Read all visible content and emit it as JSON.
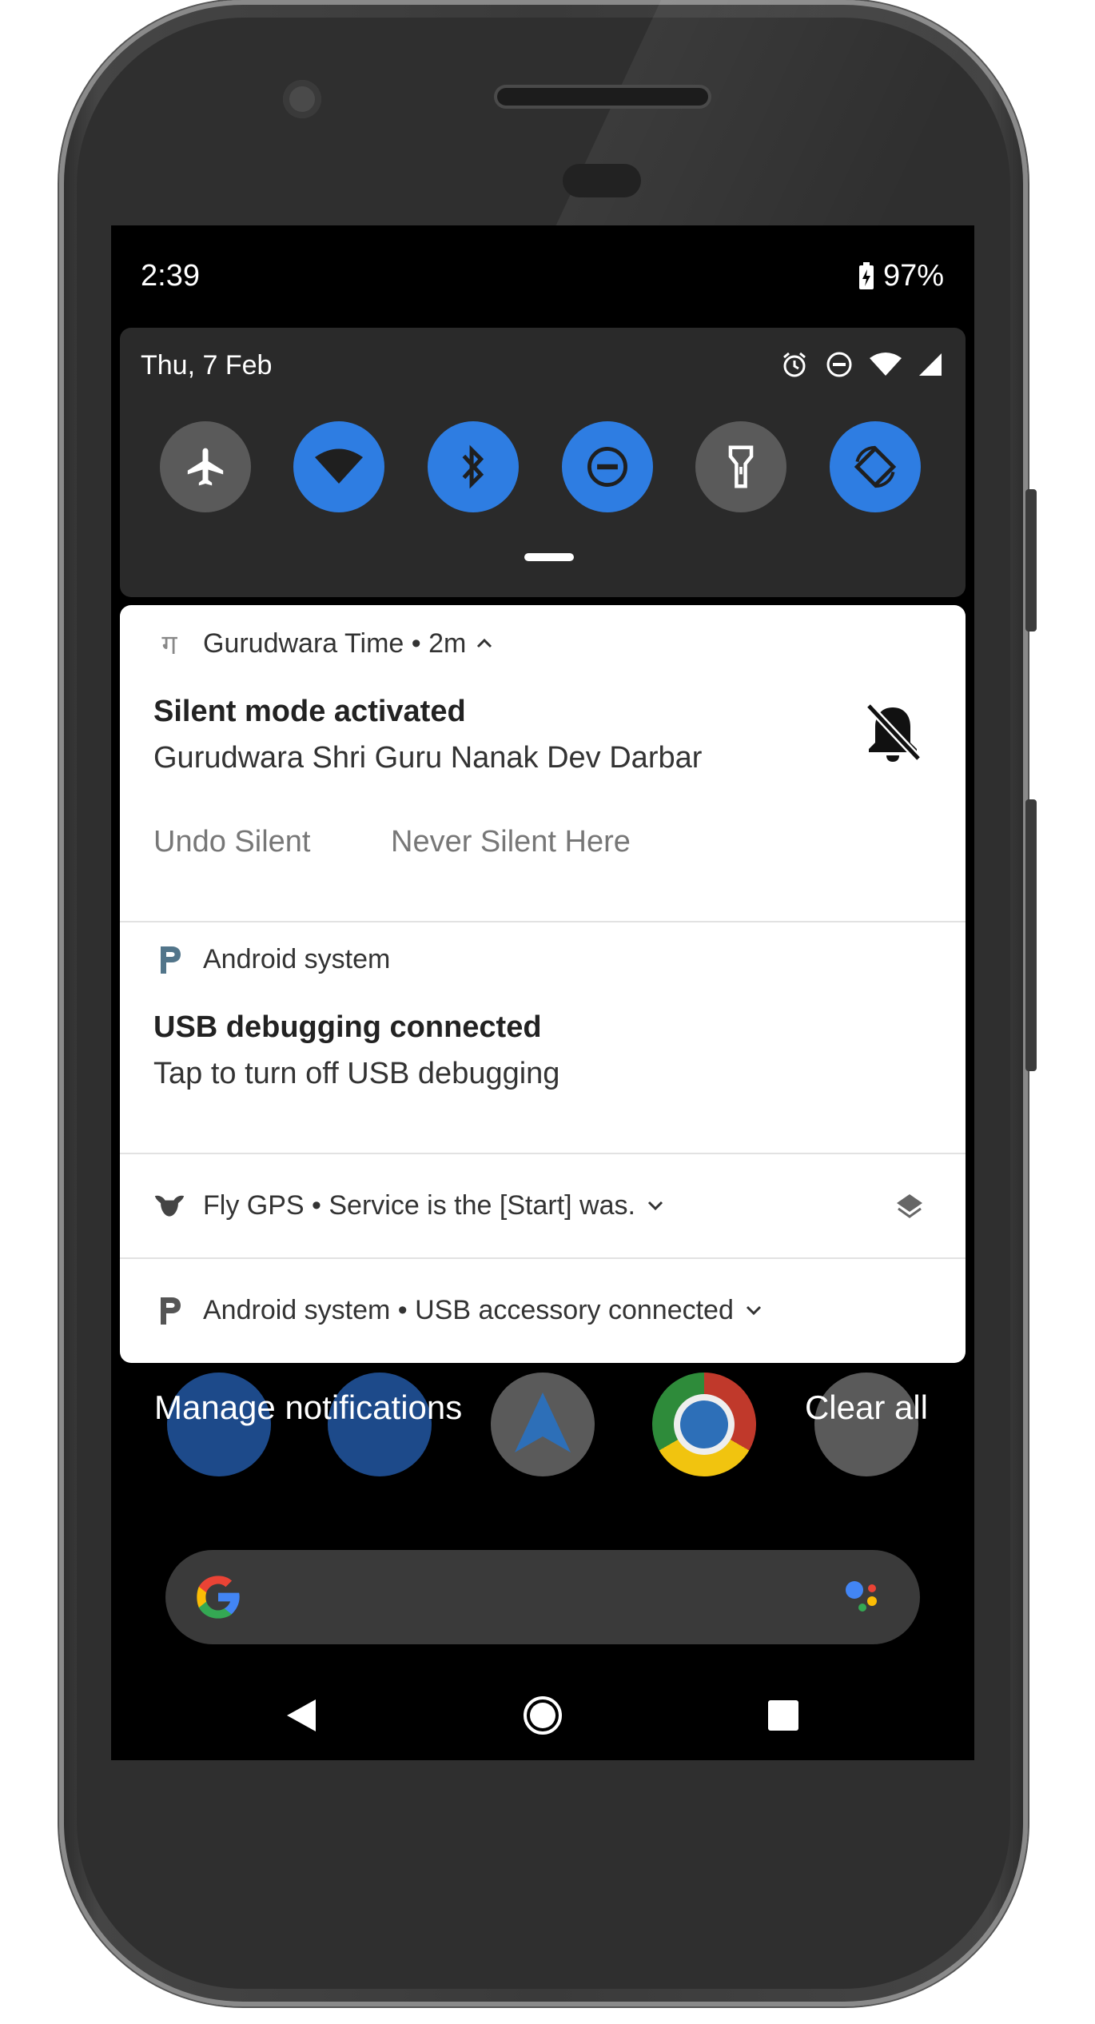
{
  "status_bar": {
    "time": "2:39",
    "battery": "97%"
  },
  "quick_settings": {
    "date": "Thu, 7 Feb",
    "tiles": [
      {
        "name": "airplane",
        "on": false
      },
      {
        "name": "wifi",
        "on": true
      },
      {
        "name": "bluetooth",
        "on": true
      },
      {
        "name": "do-not-disturb",
        "on": true
      },
      {
        "name": "flashlight",
        "on": false
      },
      {
        "name": "auto-rotate",
        "on": true
      }
    ]
  },
  "notifications": {
    "gurudwara": {
      "app_header": "Gurudwara Time • 2m",
      "title": "Silent mode activated",
      "text": "Gurudwara Shri Guru Nanak Dev Darbar",
      "action_undo": "Undo Silent",
      "action_never": "Never Silent Here"
    },
    "android_usb_debug": {
      "app_header": "Android system",
      "title": "USB debugging connected",
      "text": "Tap to turn off USB debugging"
    },
    "flygps": {
      "app_header": "Fly GPS • Service is the [Start] was."
    },
    "android_usb_accessory": {
      "app_header": "Android system • USB accessory connected"
    }
  },
  "footer": {
    "manage": "Manage notifications",
    "clear": "Clear all"
  },
  "colors": {
    "accent": "#2e7de2",
    "panel_bg": "#ffffff",
    "qs_bg": "#2a2a2a"
  }
}
